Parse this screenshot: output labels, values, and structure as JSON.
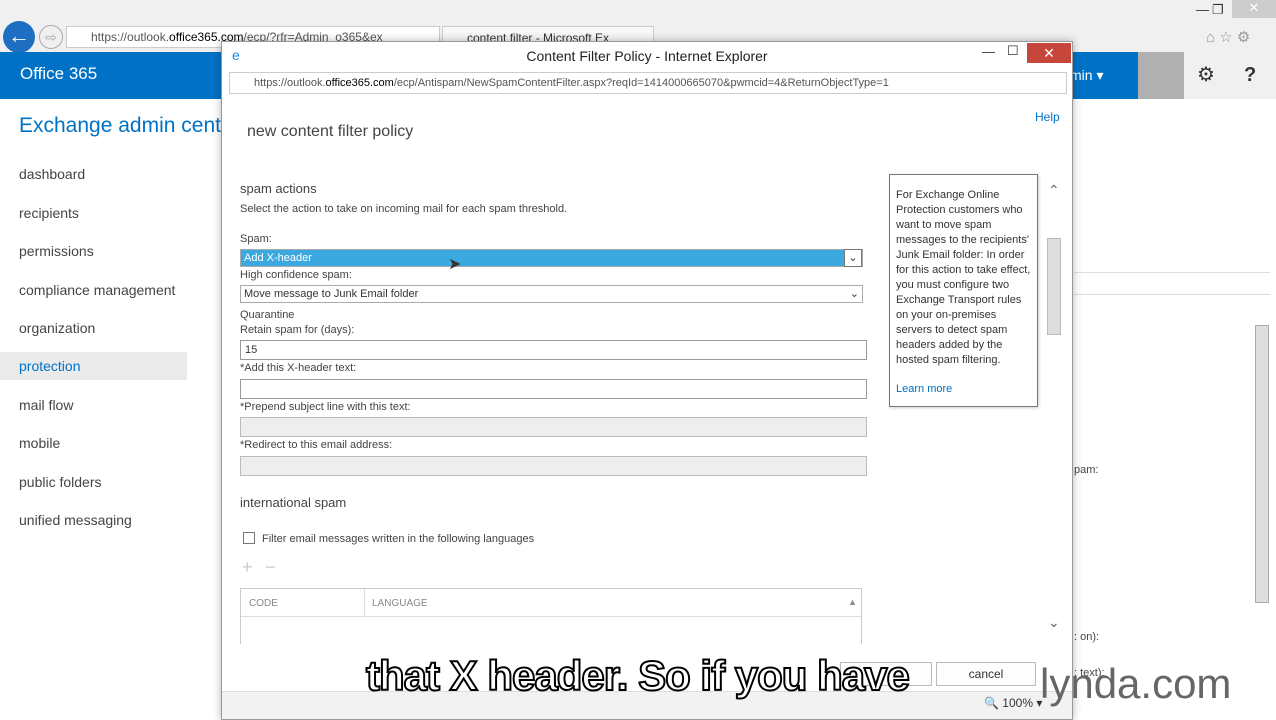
{
  "browser": {
    "back": "←",
    "forward": "⇨",
    "address_host_pre": "https://outlook.",
    "address_host": "office365.com",
    "address_path": "/ecp/?rfr=Admin_o365&ex",
    "tab": "content filter - Microsoft Ex"
  },
  "header": {
    "brand": "Office 365",
    "user": "min ▾",
    "settings": "⚙",
    "help": "?"
  },
  "page": {
    "title": "Exchange admin cente"
  },
  "sidebar": {
    "items": [
      "dashboard",
      "recipients",
      "permissions",
      "compliance management",
      "organization",
      "protection",
      "mail flow",
      "mobile",
      "public folders",
      "unified messaging"
    ],
    "selected": "protection"
  },
  "background_fragments": [
    "pam:",
    ": on):",
    ": text):"
  ],
  "popup": {
    "window_title": "Content Filter Policy - Internet Explorer",
    "address_pre": "https://outlook.",
    "address_host": "office365.com",
    "address_path": "/ecp/Antispam/NewSpamContentFilter.aspx?reqId=1414000665070&pwmcid=4&ReturnObjectType=1",
    "help": "Help",
    "heading": "new content filter policy",
    "spam_actions": {
      "title": "spam actions",
      "desc": "Select the action to take on incoming mail for each spam threshold.",
      "spam_label": "Spam:",
      "spam_value": "Add X-header",
      "high_label": "High confidence spam:",
      "high_value": "Move message to Junk Email folder",
      "quarantine": "Quarantine",
      "retain_label": "Retain spam for (days):",
      "retain_value": "15",
      "xheader_label": "*Add this X-header text:",
      "xheader_value": "",
      "prepend_label": "*Prepend subject line with this text:",
      "redirect_label": "*Redirect to this email address:"
    },
    "intl": {
      "title": "international spam",
      "filter_label": "Filter email messages written in the following languages",
      "add": "+",
      "remove": "−",
      "col_code": "CODE",
      "col_language": "LANGUAGE"
    },
    "tooltip": {
      "text": "For Exchange Online Protection customers who want to move spam messages to the recipients' Junk Email folder: In order for this action to take effect, you must configure two Exchange Transport rules on your on-premises servers to detect spam headers added by the hosted spam filtering.",
      "link": "Learn more"
    },
    "cancel": "cancel",
    "zoom": "100%"
  },
  "caption": "that X header. So if you have",
  "watermark": "lynda.com",
  "colors": {
    "brand": "#0072c6",
    "selected": "#3ba9e0",
    "close": "#c7463b"
  }
}
